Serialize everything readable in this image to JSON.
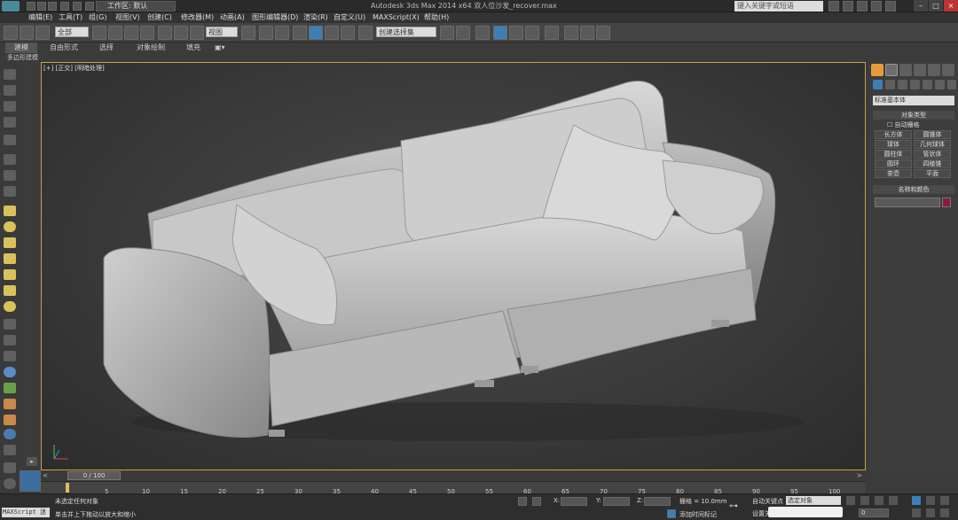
{
  "titlebar": {
    "workspace": "工作区: 默认",
    "app_title": "Autodesk 3ds Max  2014 x64      双人位沙发_recover.max",
    "search_placeholder": "键入关键字或短语"
  },
  "menu": [
    "编辑(E)",
    "工具(T)",
    "组(G)",
    "视图(V)",
    "创建(C)",
    "修改器(M)",
    "动画(A)",
    "图形编辑器(D)",
    "渲染(R)",
    "自定义(U)",
    "MAXScript(X)",
    "帮助(H)"
  ],
  "toolbar": {
    "selection_filter": "全部",
    "ref_coord": "视图",
    "named_selection": "创建选择集"
  },
  "ribbon": {
    "tabs": [
      "建模",
      "自由形式",
      "选择",
      "对象绘制",
      "填充"
    ],
    "sub_label": "多边形建模"
  },
  "viewport": {
    "label": "[+] [正交] [明暗处理]",
    "label_parts": [
      "[+]",
      "[正交]",
      "[明暗处理]"
    ]
  },
  "command_panel": {
    "category": "标准基本体",
    "object_type_title": "对象类型",
    "autogrid": "自动栅格",
    "buttons": [
      "长方体",
      "圆锥体",
      "球体",
      "几何球体",
      "圆柱体",
      "管状体",
      "圆环",
      "四棱锥",
      "茶壶",
      "平面"
    ],
    "name_color_title": "名称和颜色",
    "color": "#8a1c3a"
  },
  "timeline": {
    "frame": "0 / 100",
    "ticks": [
      "5",
      "10",
      "15",
      "20",
      "25",
      "30",
      "35",
      "40",
      "45",
      "50",
      "55",
      "60",
      "65",
      "70",
      "75",
      "80",
      "85",
      "90",
      "95",
      "100"
    ]
  },
  "status": {
    "maxscript": "MAXScript 迷",
    "line1": "未选定任何对象",
    "line2": "单击并上下拖动以放大和缩小",
    "x_label": "X:",
    "y_label": "Y:",
    "z_label": "Z:",
    "grid": "栅格 = 10.0mm",
    "add_time_tag": "添加时间标记",
    "auto_key": "自动关键点",
    "selected_obj": "选定对象",
    "set_key": "设置关键点",
    "frame_value": "0"
  }
}
